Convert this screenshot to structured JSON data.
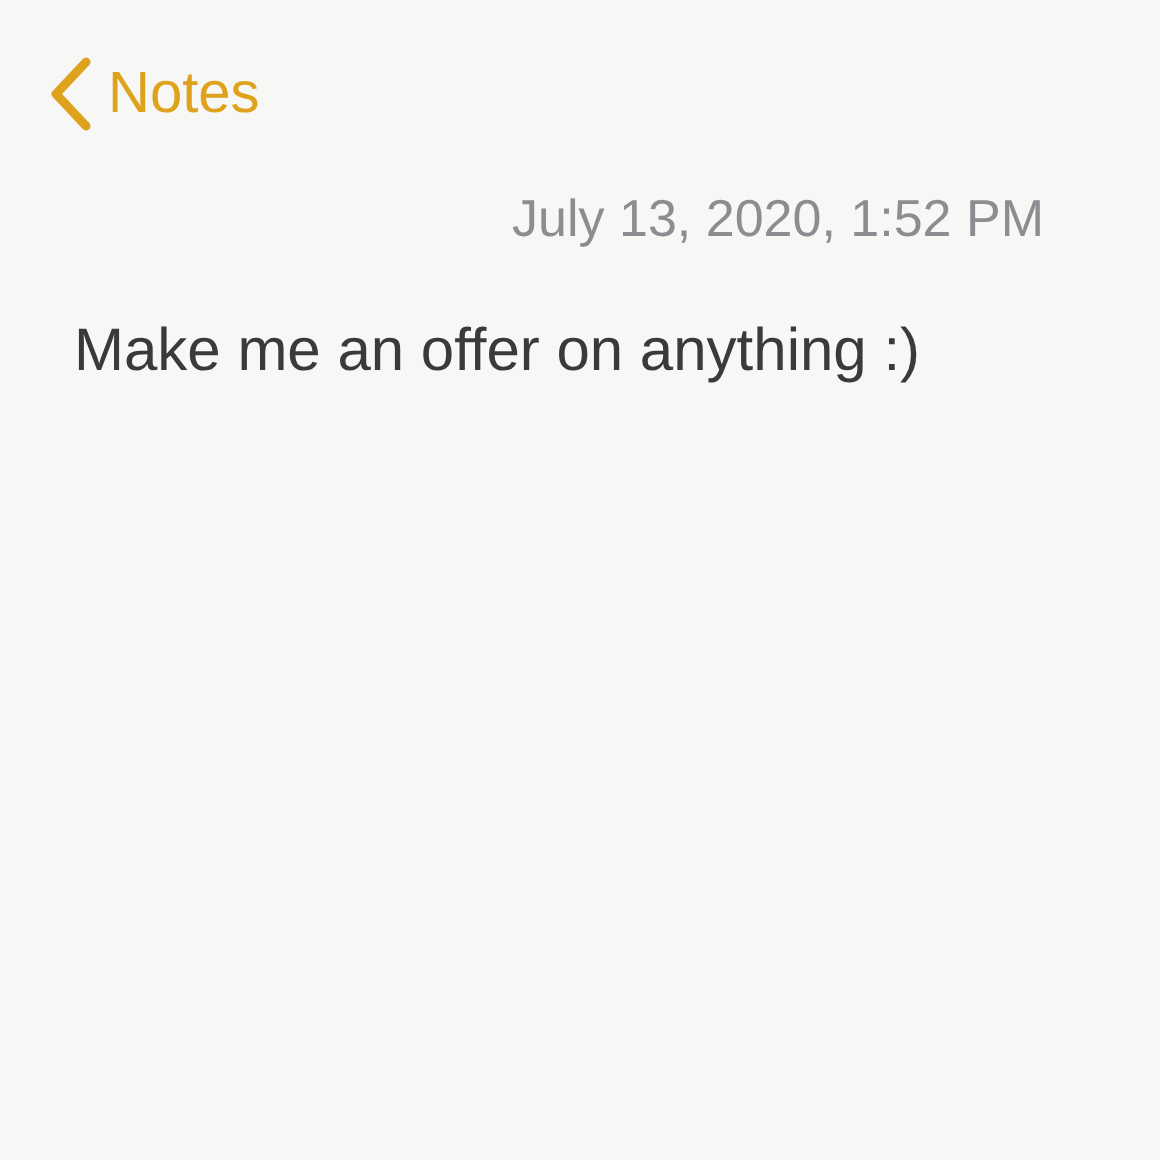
{
  "nav": {
    "back_label": "Notes"
  },
  "note": {
    "date": "July 13, 2020, 1:52 PM",
    "body": "Make me an offer on anything :)"
  }
}
